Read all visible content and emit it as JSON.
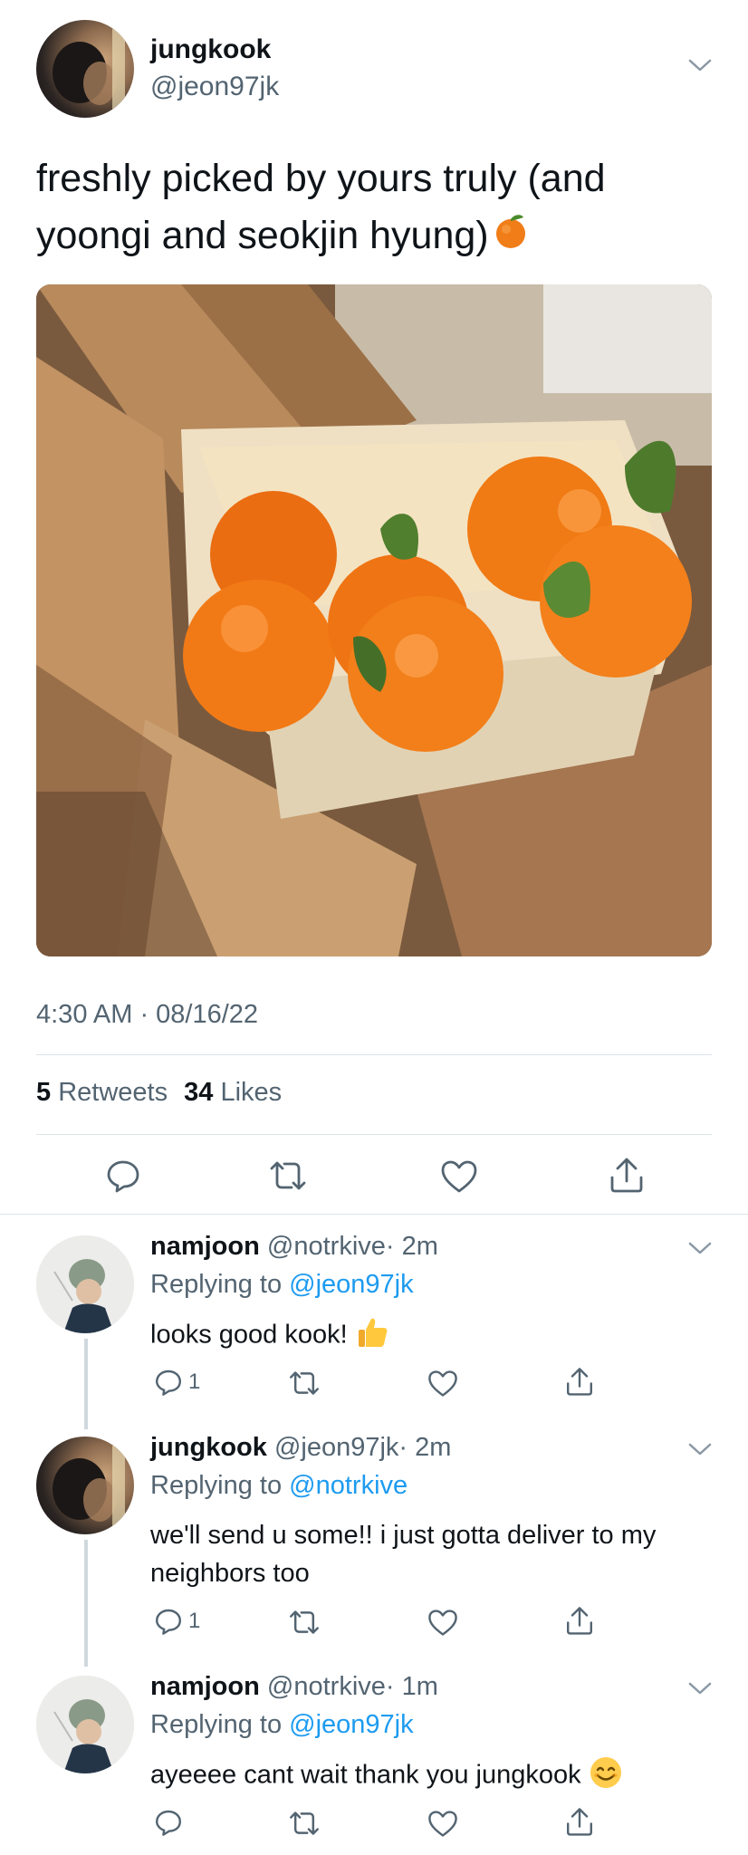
{
  "main_tweet": {
    "display_name": "jungkook",
    "handle": "@jeon97jk",
    "text": "freshly picked by yours truly (and yoongi and seokjin hyung)",
    "emoji": "orange-emoji",
    "timestamp": "4:30 AM · 08/16/22",
    "retweets_count": "5",
    "retweets_label": "Retweets",
    "likes_count": "34",
    "likes_label": "Likes"
  },
  "replies": [
    {
      "display_name": "namjoon",
      "handle": "@notrkive",
      "time": "· 2m",
      "replying_prefix": "Replying to",
      "replying_to": "@jeon97jk",
      "text": "looks good kook!",
      "emoji": "thumbs-up-emoji",
      "reply_count": "1"
    },
    {
      "display_name": "jungkook",
      "handle": "@jeon97jk",
      "time": "· 2m",
      "replying_prefix": "Replying to",
      "replying_to": "@notrkive",
      "text": "we'll send u some!! i just gotta deliver to my neighbors too",
      "reply_count": "1"
    },
    {
      "display_name": "namjoon",
      "handle": "@notrkive",
      "time": "· 1m",
      "replying_prefix": "Replying to",
      "replying_to": "@jeon97jk",
      "text": "ayeeee cant wait thank you jungkook",
      "emoji": "smiling-face-emoji",
      "reply_count": ""
    }
  ],
  "colors": {
    "link": "#1d9bf0",
    "muted": "#536471",
    "text": "#0f1419",
    "divider": "#dfe3e7"
  }
}
